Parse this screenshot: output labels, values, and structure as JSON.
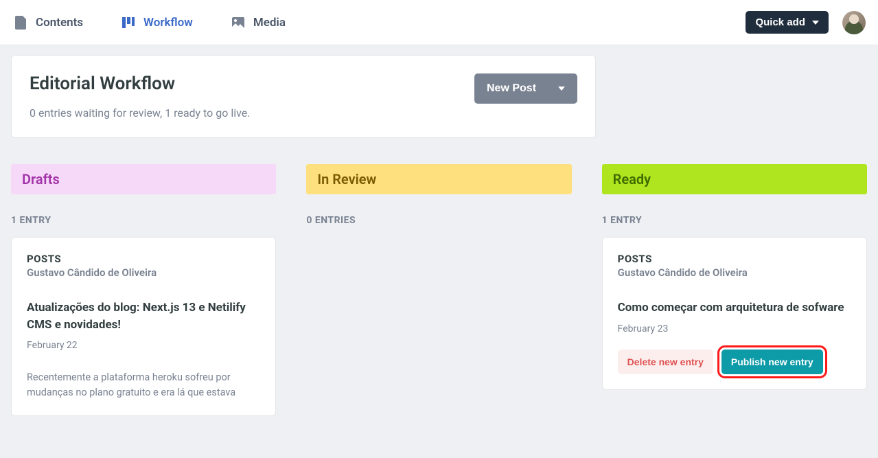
{
  "nav": {
    "contents": "Contents",
    "workflow": "Workflow",
    "media": "Media",
    "quick_add": "Quick add"
  },
  "header": {
    "title": "Editorial Workflow",
    "subtitle": "0 entries waiting for review, 1 ready to go live.",
    "new_post": "New Post"
  },
  "columns": {
    "drafts": {
      "label": "Drafts",
      "count": "1 ENTRY"
    },
    "review": {
      "label": "In Review",
      "count": "0 ENTRIES"
    },
    "ready": {
      "label": "Ready",
      "count": "1 ENTRY"
    }
  },
  "cards": {
    "draft": {
      "collection": "POSTS",
      "author": "Gustavo Cândido de Oliveira",
      "title": "Atualizações do blog: Next.js 13 e Netilify CMS e novidades!",
      "date": "February 22",
      "body": "Recentemente a plataforma heroku sofreu por mudanças no plano gratuito e era lá que estava"
    },
    "ready": {
      "collection": "POSTS",
      "author": "Gustavo Cândido de Oliveira",
      "title": "Como começar com arquitetura de sofware",
      "date": "February 23",
      "delete_label": "Delete new entry",
      "publish_label": "Publish new entry"
    }
  }
}
